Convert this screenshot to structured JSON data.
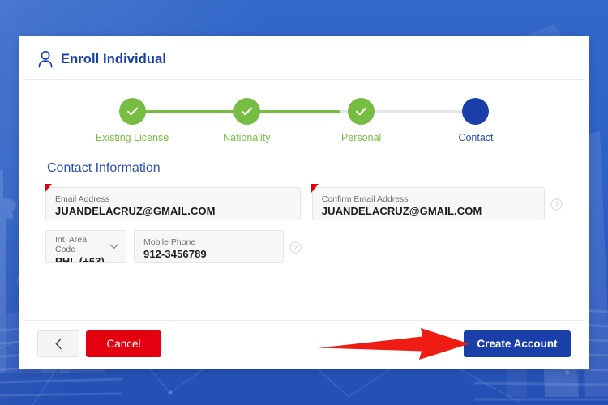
{
  "colors": {
    "brand_blue": "#1b3fa8",
    "step_green": "#78bd43",
    "cancel_red": "#e3000f",
    "annotation_red": "#ee1c13",
    "backdrop_blue": "#2f62c4",
    "field_bg": "#f7f7f8",
    "label_gray": "#6e7076"
  },
  "header": {
    "icon": "person-icon",
    "title": "Enroll Individual"
  },
  "stepper": {
    "steps": [
      {
        "label": "Existing License",
        "state": "done",
        "icon": "check-icon"
      },
      {
        "label": "Nationality",
        "state": "done",
        "icon": "check-icon"
      },
      {
        "label": "Personal",
        "state": "done",
        "icon": "check-icon"
      },
      {
        "label": "Contact",
        "state": "current",
        "icon": ""
      }
    ],
    "progress_percent": 60
  },
  "section": {
    "title": "Contact Information"
  },
  "form": {
    "fields": [
      {
        "name": "email-address",
        "label": "Email Address",
        "value": "JUANDELACRUZ@GMAIL.COM",
        "placeholder": "Email Address",
        "required": true
      },
      {
        "name": "confirm-email-address",
        "label": "Confirm Email Address",
        "value": "JUANDELACRUZ@GMAIL.COM",
        "placeholder": "Confirm Email Address",
        "required": true,
        "help": "help-icon"
      },
      {
        "name": "int-area-code",
        "label": "Int. Area Code",
        "value": "PHL (+63)",
        "placeholder": "Int. Area Code",
        "required": false,
        "control": "dropdown"
      },
      {
        "name": "mobile-phone",
        "label": "Mobile Phone",
        "value": "912-3456789",
        "placeholder": "Mobile Phone",
        "required": false,
        "help": "help-icon"
      }
    ]
  },
  "footer": {
    "back_label": "",
    "back_icon": "chevron-left-icon",
    "cancel_label": "Cancel",
    "create_label": "Create Account"
  },
  "annotation": {
    "shape": "arrow-right",
    "points_to": "create-account-button"
  }
}
